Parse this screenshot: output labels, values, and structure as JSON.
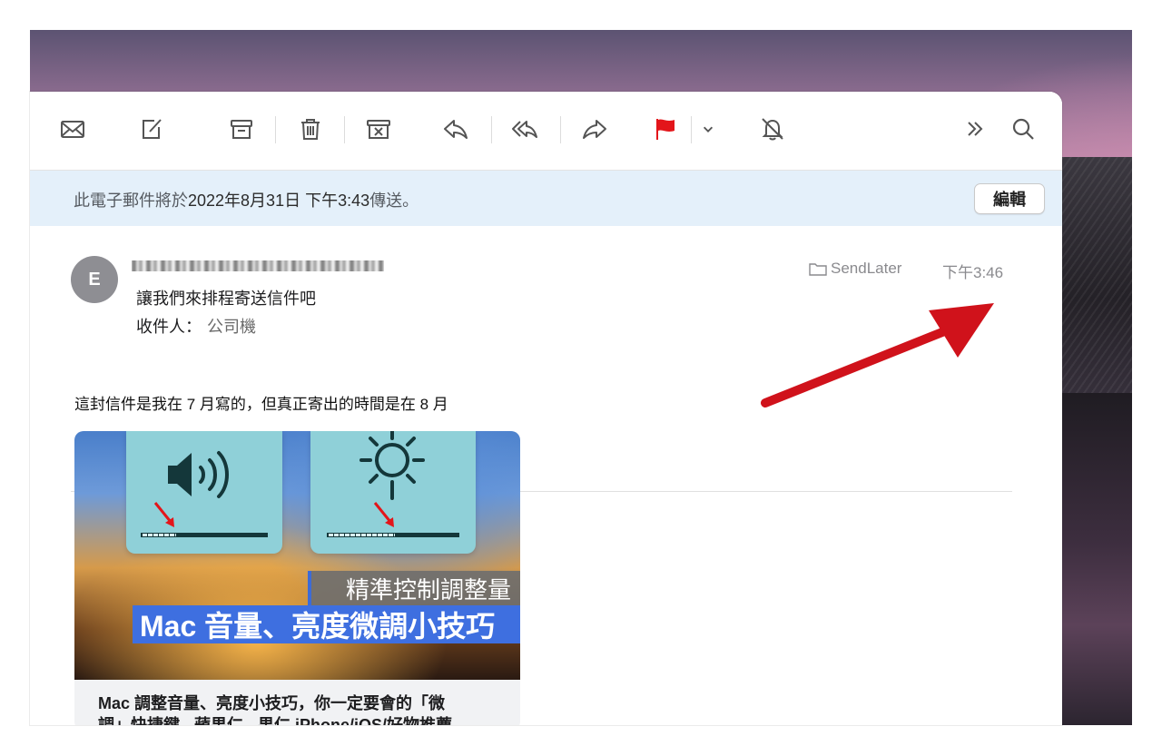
{
  "toolbar": {
    "buttons": [
      {
        "name": "get-mail",
        "icon": "envelope-icon"
      },
      {
        "name": "compose",
        "icon": "compose-icon"
      },
      {
        "name": "archive",
        "icon": "archive-icon"
      },
      {
        "name": "delete",
        "icon": "trash-icon"
      },
      {
        "name": "junk",
        "icon": "junk-icon"
      },
      {
        "name": "reply",
        "icon": "reply-icon"
      },
      {
        "name": "reply-all",
        "icon": "reply-all-icon"
      },
      {
        "name": "forward",
        "icon": "forward-icon"
      },
      {
        "name": "flag",
        "icon": "flag-icon"
      },
      {
        "name": "flag-menu",
        "icon": "chevron-down-icon"
      },
      {
        "name": "mute",
        "icon": "bell-slash-icon"
      },
      {
        "name": "more",
        "icon": "chevron-double-right-icon"
      },
      {
        "name": "search",
        "icon": "magnifier-icon"
      }
    ],
    "flag_color": "#e3151a"
  },
  "banner": {
    "prefix": "此電子郵件將於",
    "date": "2022年8月31日 下午3:43",
    "suffix": "傳送。",
    "edit_label": "編輯"
  },
  "message": {
    "avatar_initial": "E",
    "subject": "讓我們來排程寄送信件吧",
    "to_label": "收件人：",
    "to_value": "公司機",
    "mailbox": "SendLater",
    "time": "下午3:46"
  },
  "body": {
    "text": "這封信件是我在 7 月寫的，但真正寄出的時間是在 8 月"
  },
  "card": {
    "caption_top": "精準控制調整量",
    "caption_main": "Mac 音量、亮度微調小技巧",
    "title_line1": "Mac 調整音量、亮度小技巧，你一定要會的「微",
    "title_line2": "調」快捷鍵 - 蘋果仁 - 果仁 iPhone/iOS/好物推薦"
  },
  "colors": {
    "banner_bg": "#e4f0fa",
    "annotation_arrow": "#d0121b"
  }
}
